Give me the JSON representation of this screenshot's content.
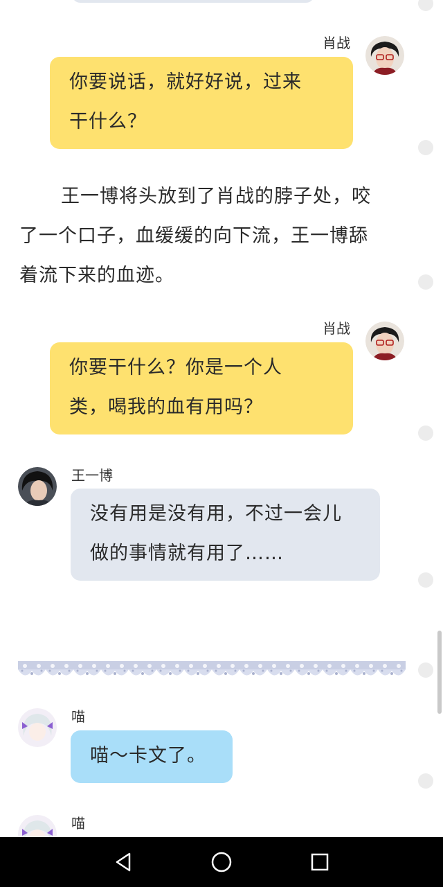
{
  "messages": [
    {
      "speaker": "肖战",
      "text": "你要说话，就好好说，过来干什么？"
    },
    {
      "narration": "王一博将头放到了肖战的脖子处，咬了一个口子，血缓缓的向下流，王一博舔着流下来的血迹。"
    },
    {
      "speaker": "肖战",
      "text": "你要干什么？你是一个人类，喝我的血有用吗？"
    },
    {
      "speaker": "王一博",
      "text": "没有用是没有用，不过一会儿做的事情就有用了……"
    },
    {
      "speaker": "喵",
      "text": "喵～卡文了。"
    },
    {
      "speaker": "喵"
    }
  ],
  "lines": {
    "m1": [
      "你要说话，就好好说，过来",
      "干什么？"
    ],
    "narr": [
      "王一博将头放到了肖战的脖子处，咬",
      "了一个口子，血缓缓的向下流，王一博舔",
      "着流下来的血迹。"
    ],
    "m3": [
      "你要干什么？你是一个人",
      "类，喝我的血有用吗？"
    ],
    "m4": [
      "没有用是没有用，不过一会儿",
      "做的事情就有用了……"
    ]
  },
  "colors": {
    "yellow_bubble": "#fee16f",
    "gray_bubble": "#e2e7ef",
    "blue_bubble": "#a9def9",
    "nav_bar": "#000000"
  },
  "icons": {
    "back": "triangle-back-icon",
    "home": "circle-home-icon",
    "recents": "square-recents-icon"
  }
}
